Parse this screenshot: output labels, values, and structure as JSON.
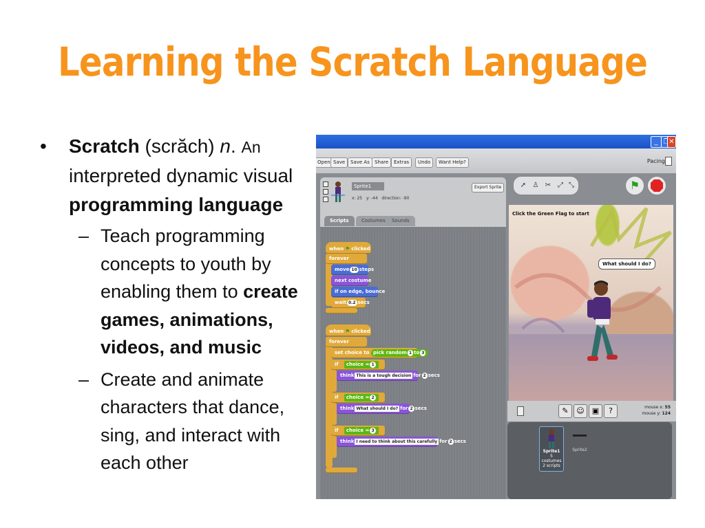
{
  "slide": {
    "title": "Learning the Scratch Language",
    "bullet1": {
      "term": "Scratch",
      "pron": " (scrăch) ",
      "pos": "n",
      "dot": ". ",
      "lead": "An",
      "line2": "interpreted dynamic visual",
      "bold_end": "programming language"
    },
    "sub1": {
      "text": "Teach programming concepts to youth by enabling them to ",
      "bold": "create games, animations, videos, and music"
    },
    "sub2": {
      "text": "Create and animate characters that dance, sing, and interact with each other"
    }
  },
  "scratch": {
    "menu": [
      "Open",
      "Save",
      "Save As",
      "Share",
      "Extras",
      "Undo",
      "Want Help?"
    ],
    "pacing": "Pacing",
    "sprite_name": "Sprite1",
    "coords": "x: 25   y: -44   direction: -90",
    "export": "Export Sprite",
    "tabs": [
      "Scripts",
      "Costumes",
      "Sounds"
    ],
    "script1": {
      "hat": "when",
      "hat2": "clicked",
      "forever": "forever",
      "move": "move",
      "move_n": "10",
      "move2": "steps",
      "next": "next costume",
      "bounce": "if on edge, bounce",
      "wait": "wait",
      "wait_n": "0.2",
      "wait2": "secs"
    },
    "script2": {
      "hat": "when",
      "hat2": "clicked",
      "forever": "forever",
      "set": "set choice to",
      "pick": "pick random",
      "pick_a": "1",
      "pick_to": "to",
      "pick_b": "3",
      "if": "if",
      "choice": "choice",
      "eq": "=",
      "v1": "1",
      "v2": "2",
      "v3": "3",
      "think": "think",
      "t1": "This is a tough decision",
      "t2": "What should I do?",
      "t3": "I need to think about this carefully",
      "for": "for",
      "secs_n": "2",
      "secs": "secs"
    },
    "stage": {
      "hint": "Click the Green Flag to start",
      "bubble": "What should I do?"
    },
    "mouse_x_label": "mouse x:",
    "mouse_x": "55",
    "mouse_y_label": "mouse y:",
    "mouse_y": "124",
    "sprites": [
      {
        "name": "Sprite1",
        "costumes": "5 costumes",
        "scripts": "2 scripts"
      },
      {
        "name": "Sprite2"
      }
    ]
  }
}
